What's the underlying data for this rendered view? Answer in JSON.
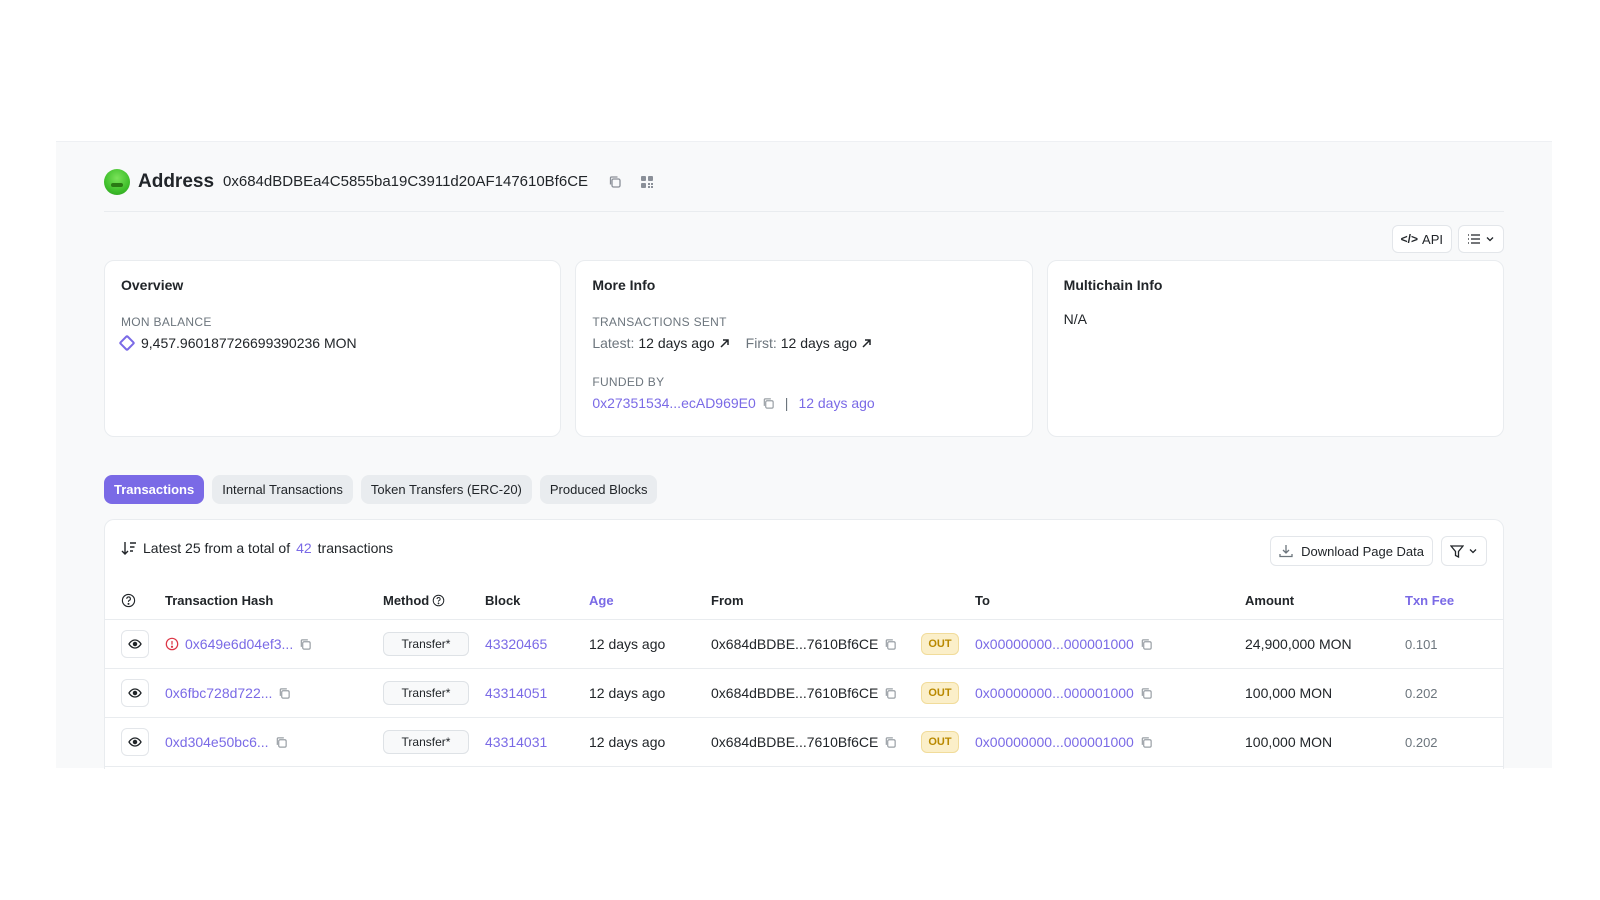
{
  "header": {
    "title": "Address",
    "address": "0x684dBDBEa4C5855ba19C3911d20AF147610Bf6CE"
  },
  "toolbar": {
    "api_label": "API"
  },
  "overview": {
    "title": "Overview",
    "balance_label": "MON BALANCE",
    "balance_value": "9,457.960187726699390236 MON"
  },
  "more_info": {
    "title": "More Info",
    "tx_sent_label": "TRANSACTIONS SENT",
    "latest_label": "Latest:",
    "latest_value": "12 days ago",
    "first_label": "First:",
    "first_value": "12 days ago",
    "funded_by_label": "FUNDED BY",
    "funded_by_address": "0x27351534...ecAD969E0",
    "separator": "|",
    "funded_age": "12 days ago"
  },
  "multichain": {
    "title": "Multichain Info",
    "value": "N/A"
  },
  "tabs": [
    {
      "label": "Transactions",
      "active": true
    },
    {
      "label": "Internal Transactions",
      "active": false
    },
    {
      "label": "Token Transfers (ERC-20)",
      "active": false
    },
    {
      "label": "Produced Blocks",
      "active": false
    }
  ],
  "tx_summary": {
    "prefix": "Latest 25 from a total of",
    "count": "42",
    "suffix": "transactions",
    "download_label": "Download Page Data"
  },
  "table": {
    "headers": {
      "hash": "Transaction Hash",
      "method": "Method",
      "block": "Block",
      "age": "Age",
      "from": "From",
      "to": "To",
      "amount": "Amount",
      "fee": "Txn Fee"
    },
    "rows": [
      {
        "hash": "0x649e6d04ef3...",
        "error": true,
        "method": "Transfer*",
        "block": "43320465",
        "age": "12 days ago",
        "from": "0x684dBDBE...7610Bf6CE",
        "direction": "OUT",
        "to": "0x00000000...000001000",
        "amount": "24,900,000 MON",
        "fee": "0.101"
      },
      {
        "hash": "0x6fbc728d722...",
        "error": false,
        "method": "Transfer*",
        "block": "43314051",
        "age": "12 days ago",
        "from": "0x684dBDBE...7610Bf6CE",
        "direction": "OUT",
        "to": "0x00000000...000001000",
        "amount": "100,000 MON",
        "fee": "0.202"
      },
      {
        "hash": "0xd304e50bc6...",
        "error": false,
        "method": "Transfer*",
        "block": "43314031",
        "age": "12 days ago",
        "from": "0x684dBDBE...7610Bf6CE",
        "direction": "OUT",
        "to": "0x00000000...000001000",
        "amount": "100,000 MON",
        "fee": "0.202"
      }
    ]
  },
  "colors": {
    "accent": "#7a6ae6",
    "out_badge_bg": "#fbefc9",
    "out_badge_text": "#b98900",
    "error": "#dc3545"
  }
}
